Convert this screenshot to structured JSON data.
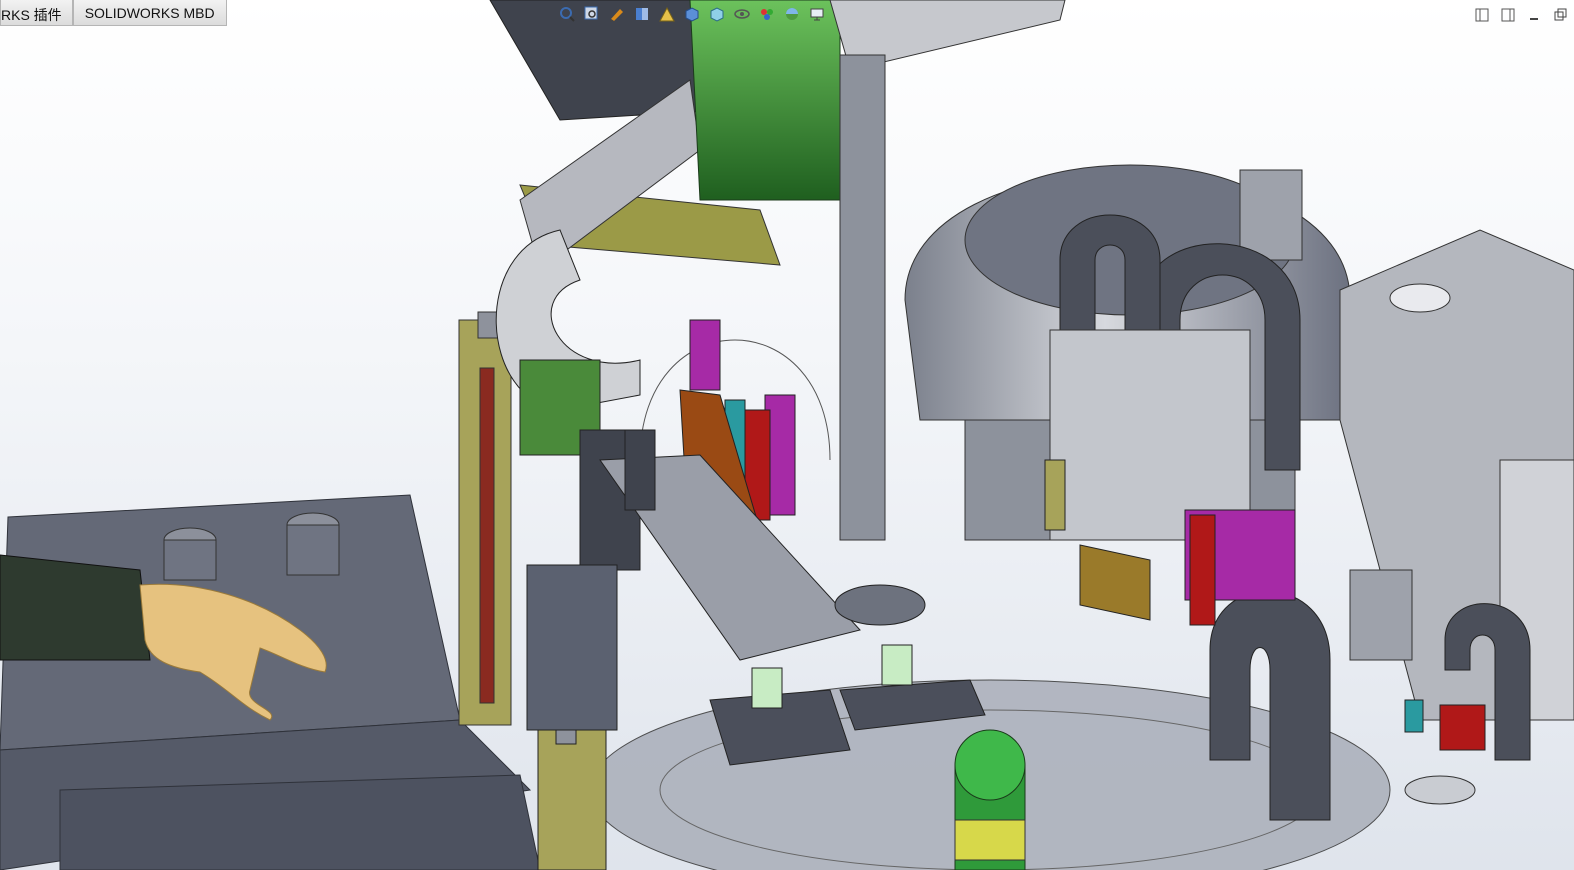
{
  "command_manager_tabs": [
    {
      "label": "RKS 插件"
    },
    {
      "label": "SOLIDWORKS MBD"
    }
  ],
  "heads_up_toolbar": {
    "icons": [
      "zoom-to-fit-icon",
      "zoom-to-area-icon",
      "previous-view-icon",
      "section-view-icon",
      "dynamic-annotation-icon",
      "view-orientation-icon",
      "display-style-icon",
      "hide-show-items-icon",
      "edit-appearance-icon",
      "apply-scene-icon",
      "view-settings-icon"
    ]
  },
  "window_controls": [
    "tile-left-icon",
    "tile-right-icon",
    "minimize-icon",
    "restore-icon"
  ],
  "colors": {
    "background_top": "#ffffff",
    "background_bottom": "#dfe4ec",
    "steel_dark": "#5b6170",
    "steel_mid": "#8d929c",
    "steel_light": "#c9ccd2",
    "olive": "#9c9a45",
    "green": "#3f8f3a",
    "magenta": "#a62aa6",
    "brown": "#9a4a14",
    "red": "#b01818",
    "skin": "#e5c07e",
    "sleeve": "#2f3a30"
  }
}
